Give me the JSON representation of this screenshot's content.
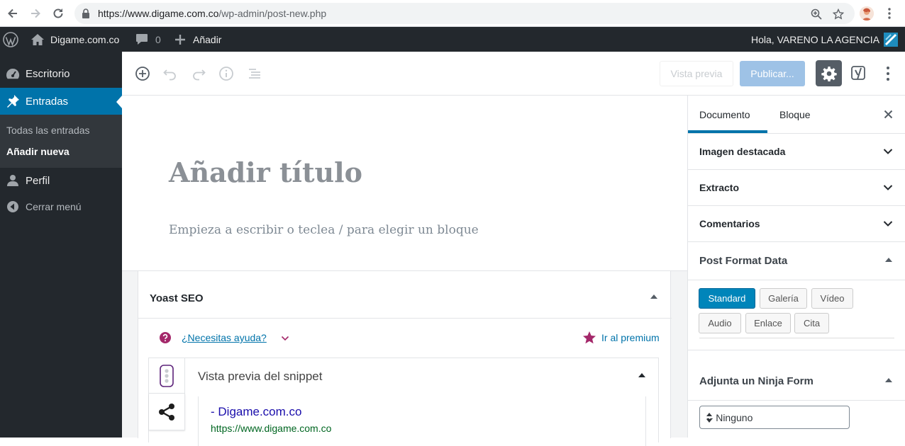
{
  "browser": {
    "url_host": "https://www.digame.com.co",
    "url_path": "/wp-admin/post-new.php"
  },
  "admin_bar": {
    "site_name": "Digame.com.co",
    "comments_count": "0",
    "add_new": "Añadir",
    "greeting": "Hola, VARENO LA AGENCIA"
  },
  "sidebar": {
    "items": [
      {
        "label": "Escritorio",
        "icon": "dashboard-icon"
      },
      {
        "label": "Entradas",
        "icon": "pin-icon"
      },
      {
        "label": "Perfil",
        "icon": "user-icon"
      },
      {
        "label": "Cerrar menú",
        "icon": "collapse-icon"
      }
    ],
    "submenu": [
      {
        "label": "Todas las entradas"
      },
      {
        "label": "Añadir nueva"
      }
    ]
  },
  "toolbar": {
    "preview_label": "Vista previa",
    "publish_label": "Publicar..."
  },
  "editor": {
    "title_placeholder": "Añadir título",
    "block_placeholder": "Empieza a escribir o teclea / para elegir un bloque"
  },
  "yoast": {
    "title": "Yoast SEO",
    "help_label": "¿Necesitas ayuda?",
    "premium_label": "Ir al premium",
    "snippet_title": "Vista previa del snippet",
    "snippet_site": "- Digame.com.co",
    "snippet_url": "https://www.digame.com.co"
  },
  "settings": {
    "tabs": [
      "Documento",
      "Bloque"
    ],
    "panels": [
      "Imagen destacada",
      "Extracto",
      "Comentarios"
    ],
    "post_format": {
      "title": "Post Format Data",
      "options": [
        "Standard",
        "Galería",
        "Vídeo",
        "Audio",
        "Enlace",
        "Cita"
      ],
      "selected": "Standard"
    },
    "ninja": {
      "title": "Adjunta un Ninja Form",
      "selected": "-- Ninguno"
    }
  },
  "colors": {
    "accent": "#0073aa",
    "admin_bar": "#23282d",
    "publish_disabled": "#9ec2e6",
    "yoast_purple": "#a4286a"
  }
}
